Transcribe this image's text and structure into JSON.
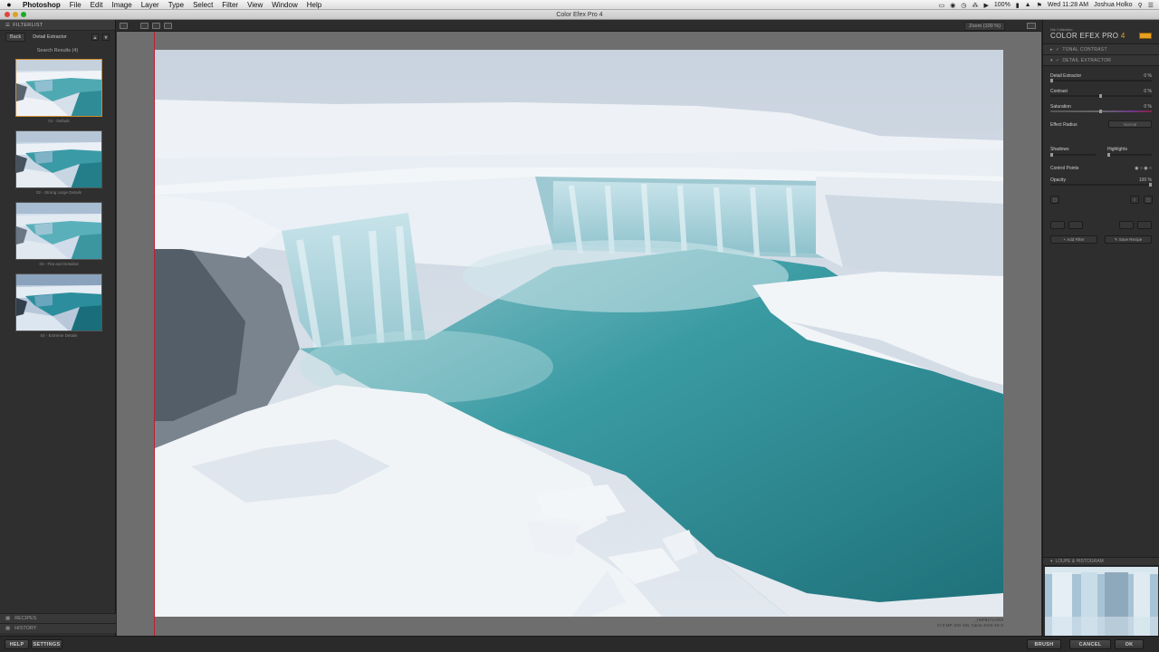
{
  "menubar": {
    "apple": "",
    "app": "Photoshop",
    "items": [
      "File",
      "Edit",
      "Image",
      "Layer",
      "Type",
      "Select",
      "Filter",
      "View",
      "Window",
      "Help"
    ],
    "battery": "100%",
    "datetime": "Wed 11:28 AM",
    "user": "Joshua Holko"
  },
  "window": {
    "title": "Color Efex Pro 4"
  },
  "left_panel": {
    "header": "FILTERLIST",
    "back": "Back",
    "breadcrumb": "Detail Extractor",
    "search_results": "Search Results (4)",
    "presets": [
      {
        "label": "01 - Default"
      },
      {
        "label": "02 - Strong Large Details"
      },
      {
        "label": "03 - Flat and Detailed"
      },
      {
        "label": "04 - Extreme Details"
      }
    ],
    "recipes": "RECIPES",
    "history": "HISTORY"
  },
  "center": {
    "zoom": "Zoom (100 %)",
    "meta_line1": "_H9P8172.CR2",
    "meta_line2": "17.9 MP, ISO 100, Canon EOS-1D X"
  },
  "right_panel": {
    "brand_small": "Nik Collection",
    "brand_big": "COLOR EFEX PRO",
    "brand_version": "4",
    "sections": {
      "tonal_contrast": "TONAL CONTRAST",
      "detail_extractor": "DETAIL EXTRACTOR"
    },
    "params": {
      "detail_extractor": {
        "label": "Detail Extractor",
        "value": "0 %",
        "level": 0.0
      },
      "contrast": {
        "label": "Contrast",
        "value": "0 %",
        "level": 0.5
      },
      "saturation": {
        "label": "Saturation",
        "value": "0 %",
        "level": 0.5
      },
      "effect_radius": {
        "label": "Effect Radius",
        "value": "Normal"
      },
      "shadows": {
        "label": "Shadows"
      },
      "highlights": {
        "label": "Highlights"
      },
      "control_points": {
        "label": "Control Points"
      },
      "opacity": {
        "label": "Opacity",
        "value": "100 %",
        "level": 1.0
      }
    },
    "add_filter": "Add Filter",
    "save_recipe": "Save Recipe",
    "loupe": "LOUPE & HISTOGRAM"
  },
  "bottom": {
    "help": "HELP",
    "settings": "SETTINGS",
    "brush": "BRUSH",
    "cancel": "CANCEL",
    "ok": "OK"
  },
  "colors": {
    "accent": "#e8a020",
    "selected_border": "#d08a2c",
    "guide_line": "#c02030",
    "water_teal": "#2e8f98"
  }
}
